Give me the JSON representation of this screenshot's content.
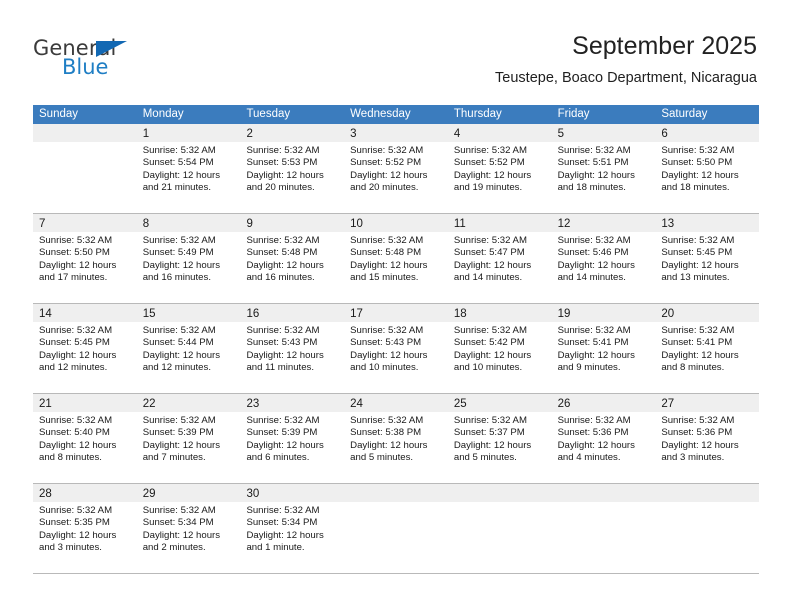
{
  "brand": {
    "name_part1": "General",
    "name_part2": "Blue",
    "triangle_color": "#1268b3",
    "blue_color": "#1f7ec4"
  },
  "header": {
    "title": "September 2025",
    "subtitle": "Teustepe, Boaco Department, Nicaragua"
  },
  "colors": {
    "header_row_bg": "#3b7cbe",
    "header_row_text": "#ffffff",
    "daynum_band_bg": "#efefef",
    "row_divider": "#b9b9b9",
    "body_text": "#1a1a1a"
  },
  "weekdays": [
    "Sunday",
    "Monday",
    "Tuesday",
    "Wednesday",
    "Thursday",
    "Friday",
    "Saturday"
  ],
  "weeks": [
    [
      {
        "day": "",
        "sunrise": "",
        "sunset": "",
        "daylight": "",
        "empty": true
      },
      {
        "day": "1",
        "sunrise": "Sunrise: 5:32 AM",
        "sunset": "Sunset: 5:54 PM",
        "daylight": "Daylight: 12 hours and 21 minutes."
      },
      {
        "day": "2",
        "sunrise": "Sunrise: 5:32 AM",
        "sunset": "Sunset: 5:53 PM",
        "daylight": "Daylight: 12 hours and 20 minutes."
      },
      {
        "day": "3",
        "sunrise": "Sunrise: 5:32 AM",
        "sunset": "Sunset: 5:52 PM",
        "daylight": "Daylight: 12 hours and 20 minutes."
      },
      {
        "day": "4",
        "sunrise": "Sunrise: 5:32 AM",
        "sunset": "Sunset: 5:52 PM",
        "daylight": "Daylight: 12 hours and 19 minutes."
      },
      {
        "day": "5",
        "sunrise": "Sunrise: 5:32 AM",
        "sunset": "Sunset: 5:51 PM",
        "daylight": "Daylight: 12 hours and 18 minutes."
      },
      {
        "day": "6",
        "sunrise": "Sunrise: 5:32 AM",
        "sunset": "Sunset: 5:50 PM",
        "daylight": "Daylight: 12 hours and 18 minutes."
      }
    ],
    [
      {
        "day": "7",
        "sunrise": "Sunrise: 5:32 AM",
        "sunset": "Sunset: 5:50 PM",
        "daylight": "Daylight: 12 hours and 17 minutes."
      },
      {
        "day": "8",
        "sunrise": "Sunrise: 5:32 AM",
        "sunset": "Sunset: 5:49 PM",
        "daylight": "Daylight: 12 hours and 16 minutes."
      },
      {
        "day": "9",
        "sunrise": "Sunrise: 5:32 AM",
        "sunset": "Sunset: 5:48 PM",
        "daylight": "Daylight: 12 hours and 16 minutes."
      },
      {
        "day": "10",
        "sunrise": "Sunrise: 5:32 AM",
        "sunset": "Sunset: 5:48 PM",
        "daylight": "Daylight: 12 hours and 15 minutes."
      },
      {
        "day": "11",
        "sunrise": "Sunrise: 5:32 AM",
        "sunset": "Sunset: 5:47 PM",
        "daylight": "Daylight: 12 hours and 14 minutes."
      },
      {
        "day": "12",
        "sunrise": "Sunrise: 5:32 AM",
        "sunset": "Sunset: 5:46 PM",
        "daylight": "Daylight: 12 hours and 14 minutes."
      },
      {
        "day": "13",
        "sunrise": "Sunrise: 5:32 AM",
        "sunset": "Sunset: 5:45 PM",
        "daylight": "Daylight: 12 hours and 13 minutes."
      }
    ],
    [
      {
        "day": "14",
        "sunrise": "Sunrise: 5:32 AM",
        "sunset": "Sunset: 5:45 PM",
        "daylight": "Daylight: 12 hours and 12 minutes."
      },
      {
        "day": "15",
        "sunrise": "Sunrise: 5:32 AM",
        "sunset": "Sunset: 5:44 PM",
        "daylight": "Daylight: 12 hours and 12 minutes."
      },
      {
        "day": "16",
        "sunrise": "Sunrise: 5:32 AM",
        "sunset": "Sunset: 5:43 PM",
        "daylight": "Daylight: 12 hours and 11 minutes."
      },
      {
        "day": "17",
        "sunrise": "Sunrise: 5:32 AM",
        "sunset": "Sunset: 5:43 PM",
        "daylight": "Daylight: 12 hours and 10 minutes."
      },
      {
        "day": "18",
        "sunrise": "Sunrise: 5:32 AM",
        "sunset": "Sunset: 5:42 PM",
        "daylight": "Daylight: 12 hours and 10 minutes."
      },
      {
        "day": "19",
        "sunrise": "Sunrise: 5:32 AM",
        "sunset": "Sunset: 5:41 PM",
        "daylight": "Daylight: 12 hours and 9 minutes."
      },
      {
        "day": "20",
        "sunrise": "Sunrise: 5:32 AM",
        "sunset": "Sunset: 5:41 PM",
        "daylight": "Daylight: 12 hours and 8 minutes."
      }
    ],
    [
      {
        "day": "21",
        "sunrise": "Sunrise: 5:32 AM",
        "sunset": "Sunset: 5:40 PM",
        "daylight": "Daylight: 12 hours and 8 minutes."
      },
      {
        "day": "22",
        "sunrise": "Sunrise: 5:32 AM",
        "sunset": "Sunset: 5:39 PM",
        "daylight": "Daylight: 12 hours and 7 minutes."
      },
      {
        "day": "23",
        "sunrise": "Sunrise: 5:32 AM",
        "sunset": "Sunset: 5:39 PM",
        "daylight": "Daylight: 12 hours and 6 minutes."
      },
      {
        "day": "24",
        "sunrise": "Sunrise: 5:32 AM",
        "sunset": "Sunset: 5:38 PM",
        "daylight": "Daylight: 12 hours and 5 minutes."
      },
      {
        "day": "25",
        "sunrise": "Sunrise: 5:32 AM",
        "sunset": "Sunset: 5:37 PM",
        "daylight": "Daylight: 12 hours and 5 minutes."
      },
      {
        "day": "26",
        "sunrise": "Sunrise: 5:32 AM",
        "sunset": "Sunset: 5:36 PM",
        "daylight": "Daylight: 12 hours and 4 minutes."
      },
      {
        "day": "27",
        "sunrise": "Sunrise: 5:32 AM",
        "sunset": "Sunset: 5:36 PM",
        "daylight": "Daylight: 12 hours and 3 minutes."
      }
    ],
    [
      {
        "day": "28",
        "sunrise": "Sunrise: 5:32 AM",
        "sunset": "Sunset: 5:35 PM",
        "daylight": "Daylight: 12 hours and 3 minutes."
      },
      {
        "day": "29",
        "sunrise": "Sunrise: 5:32 AM",
        "sunset": "Sunset: 5:34 PM",
        "daylight": "Daylight: 12 hours and 2 minutes."
      },
      {
        "day": "30",
        "sunrise": "Sunrise: 5:32 AM",
        "sunset": "Sunset: 5:34 PM",
        "daylight": "Daylight: 12 hours and 1 minute."
      },
      {
        "day": "",
        "sunrise": "",
        "sunset": "",
        "daylight": "",
        "empty": true
      },
      {
        "day": "",
        "sunrise": "",
        "sunset": "",
        "daylight": "",
        "empty": true
      },
      {
        "day": "",
        "sunrise": "",
        "sunset": "",
        "daylight": "",
        "empty": true
      },
      {
        "day": "",
        "sunrise": "",
        "sunset": "",
        "daylight": "",
        "empty": true
      }
    ]
  ]
}
